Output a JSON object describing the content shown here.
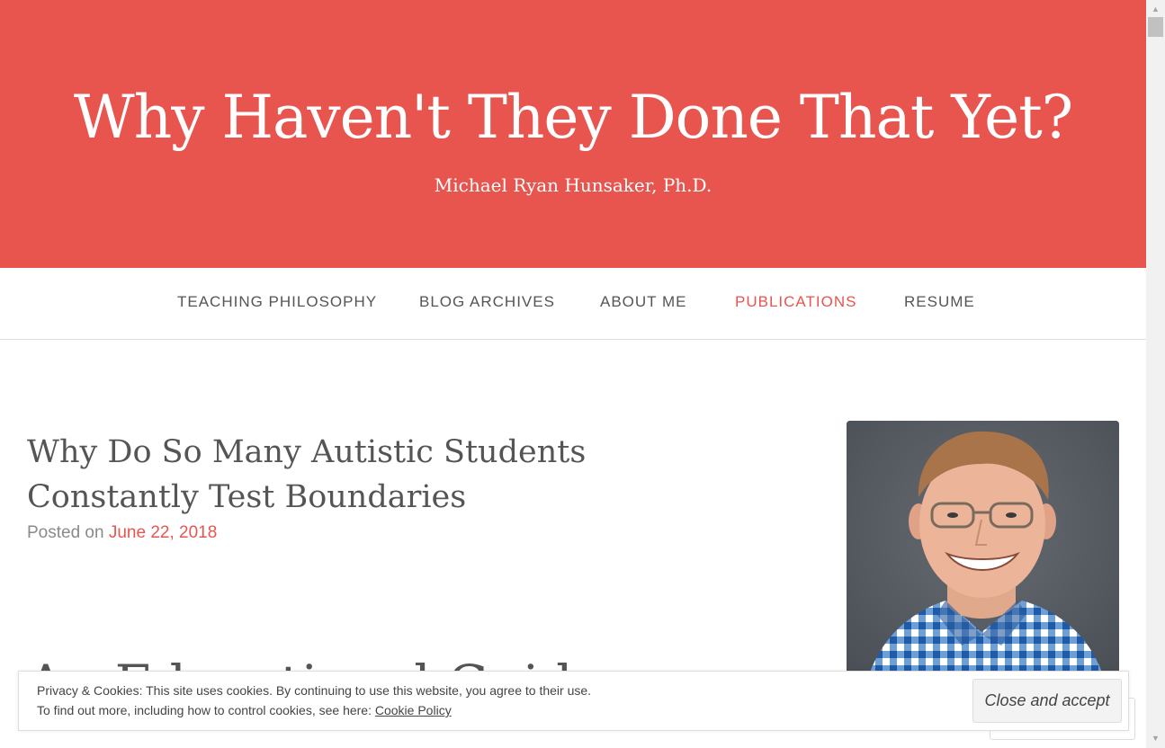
{
  "site": {
    "title": "Why Haven't They Done That Yet?",
    "description": "Michael Ryan Hunsaker, Ph.D."
  },
  "nav": {
    "items": [
      {
        "label": "TEACHING PHILOSOPHY",
        "current": false
      },
      {
        "label": "BLOG ARCHIVES",
        "current": false
      },
      {
        "label": "ABOUT ME",
        "current": false
      },
      {
        "label": "PUBLICATIONS",
        "current": true
      },
      {
        "label": "RESUME",
        "current": false
      }
    ]
  },
  "post": {
    "title_line1": "Why Do So Many Autistic Students",
    "title_line2": "Constantly Test Boundaries",
    "posted_on_label": "Posted on",
    "date": "June 22, 2018",
    "heading_partial": "An Educational Guide"
  },
  "sidebar": {
    "photo_alt": "avatar"
  },
  "cookie": {
    "line1": "Privacy & Cookies: This site uses cookies. By continuing to use this website, you agree to their use.",
    "line2_prefix": "To find out more, including how to control cookies, see here:",
    "policy_link": "Cookie Policy",
    "button": "Close and accept"
  },
  "colors": {
    "accent": "#e8554f",
    "text": "#555555",
    "muted": "#8a8a8a"
  },
  "icons": {
    "scroll_up": "triangle-up-icon",
    "scroll_down": "triangle-down-icon"
  }
}
